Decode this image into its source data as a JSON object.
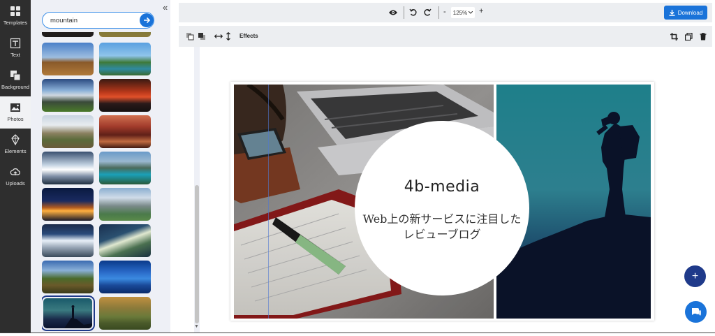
{
  "rail": {
    "items": [
      {
        "label": "Templates",
        "icon": "grid-icon"
      },
      {
        "label": "Text",
        "icon": "text-icon"
      },
      {
        "label": "Background",
        "icon": "background-icon"
      },
      {
        "label": "Photos",
        "icon": "photo-icon",
        "active": true
      },
      {
        "label": "Elements",
        "icon": "elements-icon"
      },
      {
        "label": "Uploads",
        "icon": "upload-cloud-icon"
      }
    ]
  },
  "panel": {
    "search_value": "mountain",
    "search_icon": "arrow-right-icon",
    "collapse_icon": "double-chevron-left-icon",
    "thumbnails": [
      {
        "name": "dark-partial"
      },
      {
        "name": "forest-partial"
      },
      {
        "name": "rock-peak"
      },
      {
        "name": "green-lake"
      },
      {
        "name": "cloudy-ridge"
      },
      {
        "name": "red-sunset"
      },
      {
        "name": "grassy-hills"
      },
      {
        "name": "volcano-glow"
      },
      {
        "name": "snowy-range"
      },
      {
        "name": "turquoise-lake"
      },
      {
        "name": "night-town"
      },
      {
        "name": "alpine-lake"
      },
      {
        "name": "snow-peak"
      },
      {
        "name": "river-valley"
      },
      {
        "name": "green-valley"
      },
      {
        "name": "blue-dusk"
      },
      {
        "name": "hiker-silhouette",
        "selected": true
      },
      {
        "name": "golden-hills"
      }
    ]
  },
  "topbar": {
    "preview_icon": "eye-icon",
    "undo_icon": "undo-icon",
    "redo_icon": "redo-icon",
    "zoom_minus": "-",
    "zoom_value": "125%",
    "zoom_plus": "+",
    "download_label": "Download",
    "download_icon": "download-icon"
  },
  "toolbar2": {
    "effects_label": "Effects",
    "icons": [
      "bring-forward-icon",
      "send-backward-icon",
      "flip-horizontal-icon",
      "flip-vertical-icon",
      "crop-icon",
      "duplicate-icon",
      "trash-icon"
    ]
  },
  "canvas": {
    "brand": "4b-media",
    "tagline_line1": "Web上の新サービスに注目した",
    "tagline_line2": "レビューブログ"
  },
  "fabs": {
    "add_label": "+",
    "add_icon": "plus-icon",
    "chat_icon": "chat-icon"
  },
  "colors": {
    "accent": "#1a73d9",
    "rail_bg": "#2e2e2e",
    "panel_bg": "#eef0f6",
    "fab_dark": "#1f3a8a"
  }
}
